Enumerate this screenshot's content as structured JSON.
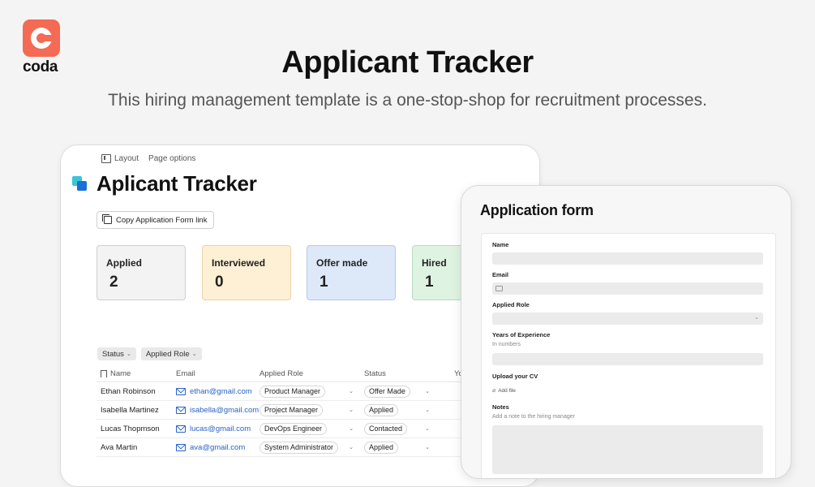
{
  "brand": {
    "name": "coda",
    "color": "#f46a54"
  },
  "hero": {
    "title": "Applicant Tracker",
    "subtitle": "This hiring management template is a one-stop-shop for recruitment processes."
  },
  "doc": {
    "toolbar": {
      "layout": "Layout",
      "page_options": "Page options"
    },
    "title": "Aplicant Tracker",
    "copy_button": "Copy Application Form link",
    "stats": [
      {
        "label": "Applied",
        "value": "2",
        "bg": "#f3f3f3",
        "border": "#cfcfcf"
      },
      {
        "label": "Interviewed",
        "value": "0",
        "bg": "#fdf0d5",
        "border": "#e8d3a5"
      },
      {
        "label": "Offer made",
        "value": "1",
        "bg": "#dde9f9",
        "border": "#b5cbe9"
      },
      {
        "label": "Hired",
        "value": "1",
        "bg": "#dff3e2",
        "border": "#b8dcbe"
      }
    ],
    "filters": [
      "Status",
      "Applied Role"
    ],
    "table": {
      "headers": {
        "name": "Name",
        "email": "Email",
        "role": "Applied Role",
        "status": "Status",
        "yo": "Yo"
      },
      "rows": [
        {
          "name": "Ethan Robinson",
          "email": "ethan@gmail.com",
          "role": "Product Manager",
          "status": "Offer Made"
        },
        {
          "name": "Isabella Martinez",
          "email": "isabella@gmail.com",
          "role": "Project Manager",
          "status": "Applied"
        },
        {
          "name": "Lucas Thopmson",
          "email": "lucas@gmail.com",
          "role": "DevOps Engineer",
          "status": "Contacted"
        },
        {
          "name": "Ava Martin",
          "email": "ava@gmail.com",
          "role": "System Administrator",
          "status": "Applied"
        }
      ]
    }
  },
  "form": {
    "title": "Application form",
    "fields": {
      "name": "Name",
      "email": "Email",
      "applied_role": "Applied Role",
      "years": "Years of Experience",
      "years_hint": "In numbers",
      "cv": "Upload your CV",
      "add_file": "Add file",
      "notes": "Notes",
      "notes_hint": "Add a note to the hiring manager"
    }
  }
}
